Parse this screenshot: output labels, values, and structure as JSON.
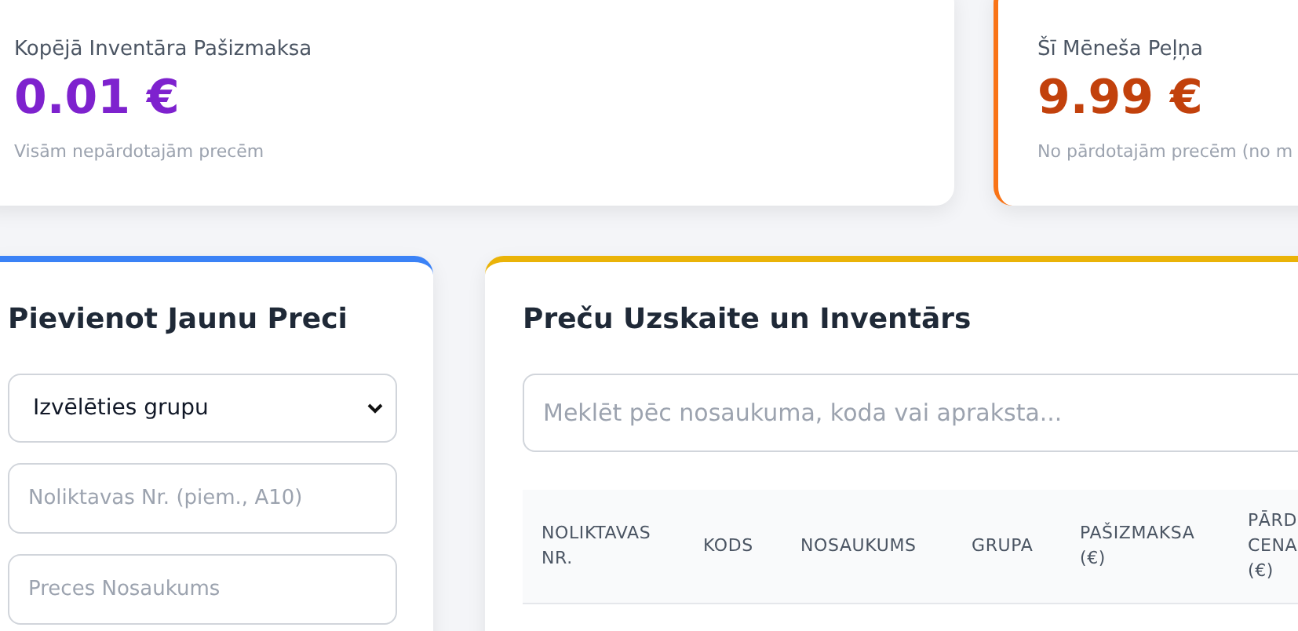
{
  "stats": [
    {
      "title": "Kopējā Inventāra Pašizmaksa",
      "value": "0.01 €",
      "note": "Visām nepārdotajām precēm",
      "kind": "cost"
    },
    {
      "title": "Šī Mēneša Peļņa",
      "value": "9.99 €",
      "note": "No pārdotajām precēm (no m",
      "kind": "profit"
    }
  ],
  "add_panel": {
    "title": "Pievienot Jaunu Preci",
    "group_select": {
      "value": "Izvēlēties grupu"
    },
    "fields": [
      {
        "placeholder": "Noliktavas Nr. (piem., A10)"
      },
      {
        "placeholder": "Preces Nosaukums"
      }
    ]
  },
  "inventory_panel": {
    "title": "Preču Uzskaite un Inventārs",
    "search": {
      "placeholder": "Meklēt pēc nosaukuma, koda vai apraksta..."
    },
    "table": {
      "columns": [
        "NOLIKTAVAS NR.",
        "KODS",
        "NOSAUKUMS",
        "GRUPA",
        "PAŠIZMAKSA (€)",
        "PĀRD CENA (€)"
      ]
    }
  }
}
